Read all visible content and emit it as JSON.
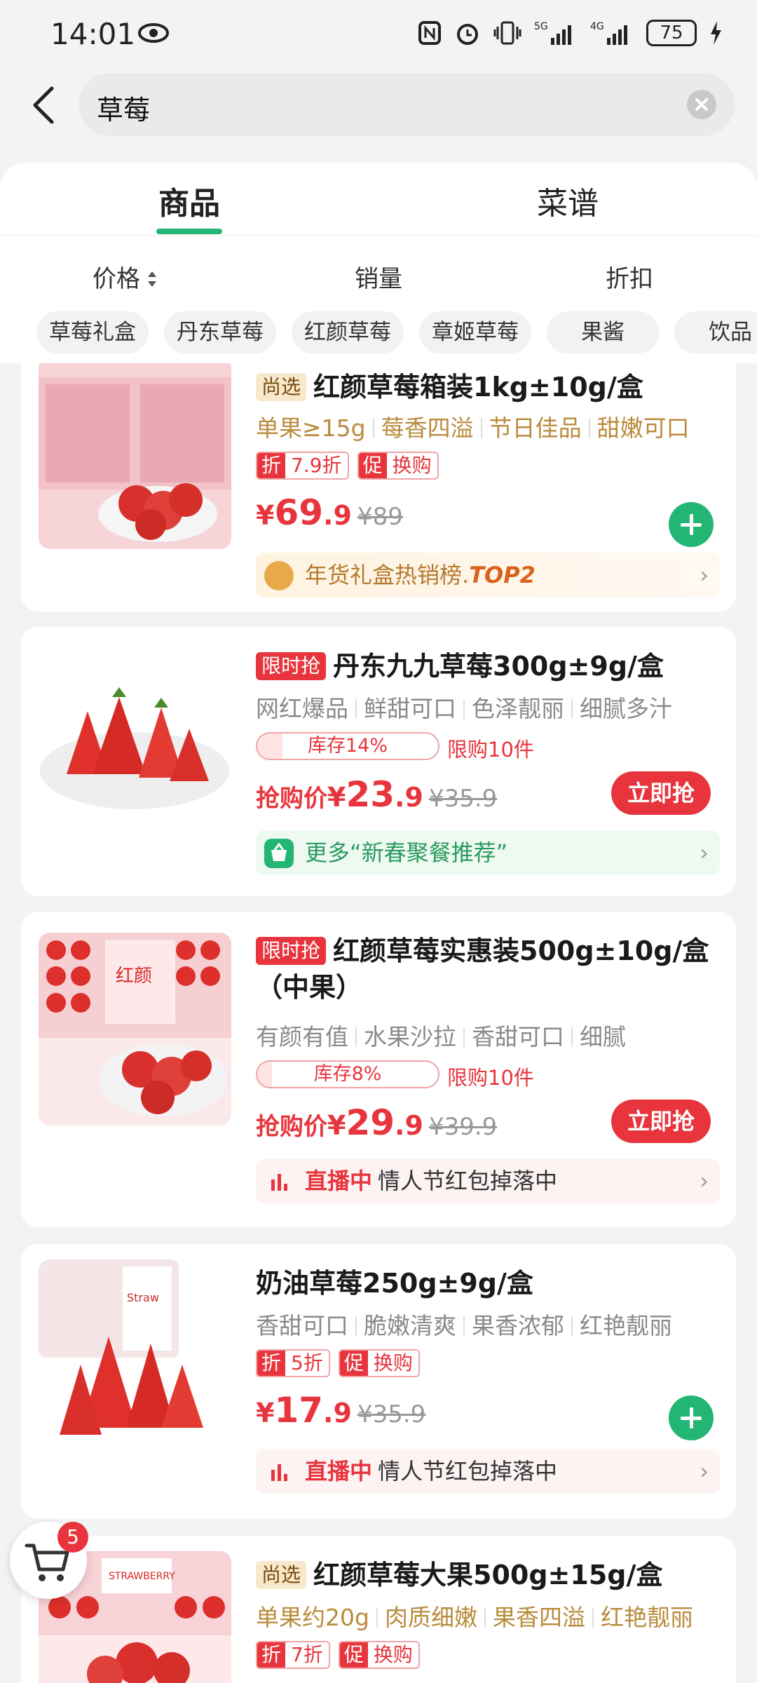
{
  "status": {
    "time": "14:01",
    "battery": "75"
  },
  "search": {
    "query": "草莓"
  },
  "tabs": [
    "商品",
    "菜谱"
  ],
  "sort": {
    "price": "价格",
    "sales": "销量",
    "discount": "折扣"
  },
  "chips": [
    "草莓礼盒",
    "丹东草莓",
    "红颜草莓",
    "章姬草莓",
    "果酱",
    "饮品"
  ],
  "products": [
    {
      "badge": "尚选",
      "title": "红颜草莓箱装1kg±10g/盒",
      "tags": [
        "单果≥15g",
        "莓香四溢",
        "节日佳品",
        "甜嫩可口"
      ],
      "promos": [
        {
          "k": "折",
          "v": "7.9折"
        },
        {
          "k": "促",
          "v": "换购"
        }
      ],
      "price": {
        "cur": "¥",
        "int": "69",
        "dec": ".9",
        "old": "¥89"
      },
      "banner": {
        "text": "年货礼盒热销榜.",
        "top": "TOP2",
        "icon": "rank-icon"
      }
    },
    {
      "badge": "限时抢",
      "title": "丹东九九草莓300g±9g/盒",
      "tags": [
        "网红爆品",
        "鲜甜可口",
        "色泽靓丽",
        "细腻多汁"
      ],
      "stock": "库存14%",
      "stock_level": 0.14,
      "limit": "限购10件",
      "price": {
        "label": "抢购价",
        "cur": "¥",
        "int": "23",
        "dec": ".9",
        "old": "¥35.9"
      },
      "button": "立即抢",
      "banner": {
        "text": "更多“新春聚餐推荐”",
        "icon": "basket-icon"
      }
    },
    {
      "badge": "限时抢",
      "title": "红颜草莓实惠装500g±10g/盒（中果）",
      "tags": [
        "有颜有值",
        "水果沙拉",
        "香甜可口",
        "细腻"
      ],
      "stock": "库存8%",
      "stock_level": 0.08,
      "limit": "限购10件",
      "price": {
        "label": "抢购价",
        "cur": "¥",
        "int": "29",
        "dec": ".9",
        "old": "¥39.9"
      },
      "button": "立即抢",
      "banner": {
        "live": "直播中",
        "text": "情人节红包掉落中",
        "icon": "live-icon"
      }
    },
    {
      "title": "奶油草莓250g±9g/盒",
      "tags": [
        "香甜可口",
        "脆嫩清爽",
        "果香浓郁",
        "红艳靓丽"
      ],
      "promos": [
        {
          "k": "折",
          "v": "5折"
        },
        {
          "k": "促",
          "v": "换购"
        }
      ],
      "price": {
        "cur": "¥",
        "int": "17",
        "dec": ".9",
        "old": "¥35.9"
      },
      "banner": {
        "live": "直播中",
        "text": "情人节红包掉落中",
        "icon": "live-icon"
      }
    },
    {
      "badge": "尚选",
      "title": "红颜草莓大果500g±15g/盒",
      "tags": [
        "单果约20g",
        "肉质细嫩",
        "果香四溢",
        "红艳靓丽"
      ],
      "promos": [
        {
          "k": "折",
          "v": "7折"
        },
        {
          "k": "促",
          "v": "换购"
        }
      ]
    }
  ],
  "cart": {
    "count": "5"
  },
  "colors": {
    "accent": "#22b573",
    "price": "#e8353d",
    "select_badge": "#f8e9cc"
  }
}
